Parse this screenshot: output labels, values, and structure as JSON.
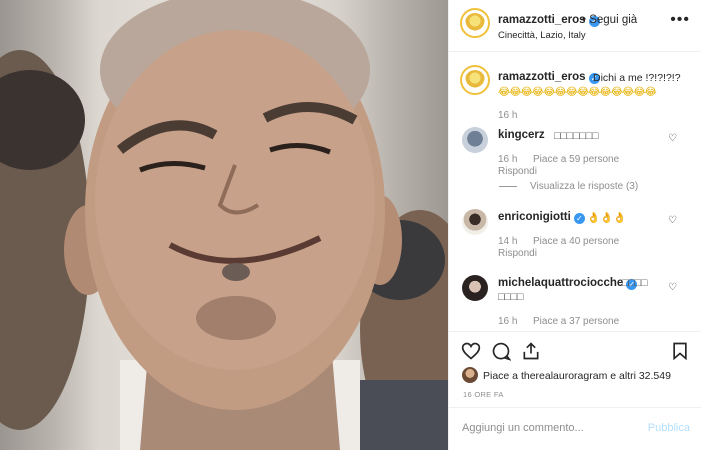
{
  "post": {
    "username": "ramazzotti_eros",
    "follow_label": "• Segui già",
    "location": "Cinecittà, Lazio, Italy",
    "more_label": "•••",
    "caption_text": "Dichi a me !?!?!?!?",
    "caption_emojis": "😂😂😂😂😂😂😂😂😂😂😂😂😂😂",
    "caption_time": "16 h"
  },
  "comments": [
    {
      "username": "kingcerz",
      "text": "□□□□□□□",
      "time": "16 h",
      "likes": "Piace a 59 persone",
      "reply": "Rispondi",
      "view_replies": "Visualizza le risposte (3)"
    },
    {
      "username": "enriconigiotti",
      "text": "👌👌👌",
      "time": "14 h",
      "likes": "Piace a 40 persone",
      "reply": "Rispondi"
    },
    {
      "username": "michelaquattrociocche",
      "text": "□□□□",
      "text2": "□□□□",
      "time": "16 h",
      "likes": "Piace a 37 persone"
    }
  ],
  "actions": {
    "like_icon": "heart-icon",
    "comment_icon": "comment-icon",
    "share_icon": "share-icon",
    "save_icon": "bookmark-icon"
  },
  "likes_text": "Piace a therealauroragram e altri 32.549",
  "time_ago": "16 ORE FA",
  "comment_box": {
    "placeholder": "Aggiungi un commento...",
    "publish_label": "Pubblica"
  }
}
